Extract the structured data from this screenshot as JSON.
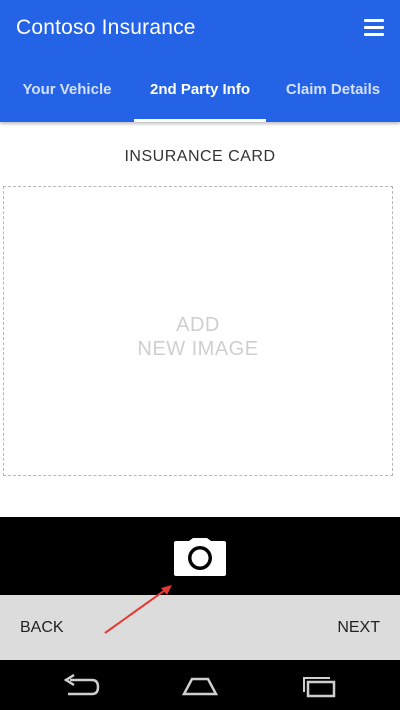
{
  "app": {
    "title": "Contoso Insurance",
    "accent_color": "#2563e6",
    "menu_icon": "hamburger-menu-icon"
  },
  "tabs": [
    {
      "label": "Your Vehicle",
      "active": false
    },
    {
      "label": "2nd Party Info",
      "active": true
    },
    {
      "label": "Claim Details",
      "active": false
    }
  ],
  "insurance_card": {
    "title": "INSURANCE CARD",
    "add_image_line1": "ADD",
    "add_image_line2": "NEW IMAGE"
  },
  "camera": {
    "icon": "camera-icon"
  },
  "actions": {
    "back_label": "BACK",
    "next_label": "NEXT"
  },
  "system_nav": {
    "back_icon": "nav-back-icon",
    "home_icon": "nav-home-icon",
    "recents_icon": "nav-recents-icon"
  }
}
